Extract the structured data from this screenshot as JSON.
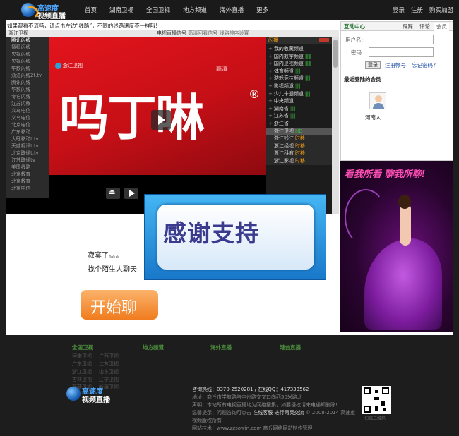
{
  "header": {
    "logo_line1": "高速度",
    "logo_line2": "视频直播",
    "nav": [
      "首页",
      "湖南卫视",
      "全国卫视",
      "地方频道",
      "海外直播",
      "更多"
    ],
    "right_links": [
      "登录",
      "注册",
      "购买加盟"
    ]
  },
  "notice": "如果观看不流畅，请点击左边“线路”，不同的线路速度不一样哦!",
  "player": {
    "current_channel": "浙江卫视",
    "info_label": "电视直播信号",
    "info_rest": "高清回看信号  线路排序设置",
    "channels_left": [
      "腾讯闪线",
      "搜狐闪线",
      "央视闪线",
      "央视闪线",
      "华数闪线",
      "浙江闪线2t.tv",
      "腾讯闪线",
      "华数闪线",
      "专它闪线",
      "江苏闪移",
      "义乌电信",
      "义乌电信",
      "北京电信",
      "广东移动",
      "大旺移动t.tv",
      "天威视讯t.tv",
      "北京联通t.tv",
      "江苏联通tv",
      "美国线路",
      "北京教育",
      "北京教育",
      "北京电信"
    ],
    "video_logo": "浙江卫视",
    "video_hd": "高清",
    "video_big_text": "吗丁啉",
    "video_reg": "®",
    "list_header": "闪播",
    "list_items": [
      {
        "label": "我的收藏频道",
        "bars": ""
      },
      {
        "label": "国内数字频道",
        "bars": "||||||"
      },
      {
        "label": "国内卫视频道",
        "bars": "||||||"
      },
      {
        "label": "体育频道",
        "bars": "|||||"
      },
      {
        "label": "游戏竞技频道",
        "bars": "|||||"
      },
      {
        "label": "影视频道",
        "bars": "|||||"
      },
      {
        "label": "少儿卡通频道",
        "bars": "|||||"
      },
      {
        "label": "中央频道",
        "bars": ""
      },
      {
        "label": "湖南省",
        "bars": "|||||"
      },
      {
        "label": "江苏省",
        "bars": "|||||"
      },
      {
        "label": "浙江省",
        "bars": ""
      }
    ],
    "sub_items": [
      {
        "label": "浙江卫视",
        "tag": "HD",
        "tag_color": "g",
        "selected": true
      },
      {
        "label": "浙江钱江",
        "tag": "时移",
        "tag_color": "y",
        "selected": false
      },
      {
        "label": "浙江经视",
        "tag": "时移",
        "tag_color": "y",
        "selected": false
      },
      {
        "label": "浙江科教",
        "tag": "时移",
        "tag_color": "y",
        "selected": false
      },
      {
        "label": "浙江影视",
        "tag": "时移",
        "tag_color": "y",
        "selected": false
      }
    ]
  },
  "thanks_banner": "感谢支持",
  "chat": {
    "line1": "寂寞了。。。",
    "line2": "找个陌生人聊天",
    "start_button": "开始聊"
  },
  "sidebar": {
    "title": "互动中心",
    "tabs": [
      "踩踩",
      "评论",
      "会员"
    ],
    "username_label": "用户名:",
    "password_label": "密码:",
    "login_button": "登录",
    "register_link": "注册帐号",
    "forgot_link": "忘记密码?",
    "recent_title": "最近登陆的会员",
    "recent_user": "河南人"
  },
  "ad": {
    "title": "看我所看 聊我所聊!"
  },
  "footer": {
    "columns": [
      {
        "title": "全国卫视",
        "links": [
          "河南卫视",
          "广西卫视",
          "广东卫视",
          "江苏卫视",
          "浙江卫视",
          "山东卫视",
          "吉林卫视",
          "辽宁卫视",
          "西藏卫视",
          "新疆卫视"
        ]
      },
      {
        "title": "地方频道",
        "links": []
      },
      {
        "title": "海外直播",
        "links": []
      },
      {
        "title": "港台直播",
        "links": []
      }
    ],
    "logo_line1": "高速度",
    "logo_line2": "视频直播",
    "hotline": "咨询热线：0370-2520281   /   在线QQ：417333562",
    "address": "地址：商丘市学航路与中州路交叉口向西50米路北",
    "statement": "声明：本站所有电视直播均为网络搜集，如要侵权请来电通知删除!",
    "tip_prefix": "温馨提示：问题咨询可点击",
    "tip_links": "在线客服  进行网页交流",
    "copyright": "© 2008-2014 高速度视频版权所有",
    "tech": "网站技术：www.zzsowin.com  商丘网络网站制作管理",
    "qr_caption": "扫描二维码"
  }
}
